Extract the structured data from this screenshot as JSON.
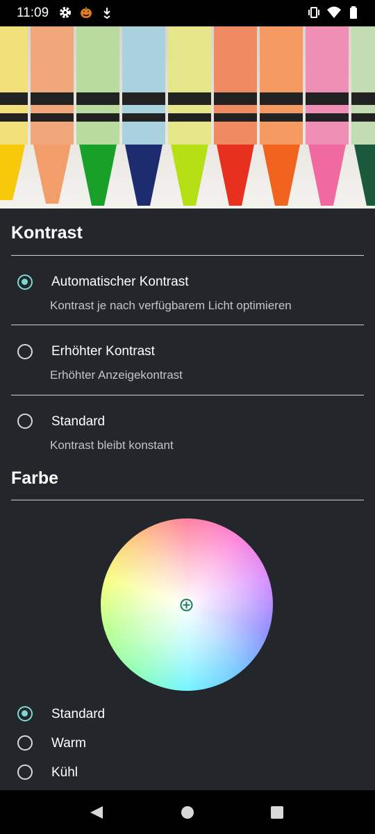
{
  "status_bar": {
    "time": "11:09",
    "icons": [
      "gear-icon",
      "pumpkin-icon",
      "download-icon",
      "vibrate-icon",
      "wifi-icon",
      "battery-icon"
    ]
  },
  "header_image": {
    "description_icon": "crayons-image"
  },
  "kontrast": {
    "title": "Kontrast",
    "options": [
      {
        "label": "Automatischer Kontrast",
        "subtitle": "Kontrast je nach verfügbarem Licht optimieren",
        "checked": true
      },
      {
        "label": "Erhöhter Kontrast",
        "subtitle": "Erhöhter Anzeigekontrast",
        "checked": false
      },
      {
        "label": "Standard",
        "subtitle": "Kontrast bleibt konstant",
        "checked": false
      }
    ]
  },
  "farbe": {
    "title": "Farbe",
    "options": [
      {
        "label": "Standard",
        "checked": true
      },
      {
        "label": "Warm",
        "checked": false
      },
      {
        "label": "Kühl",
        "checked": false
      }
    ]
  },
  "nav_bar": {
    "icons": [
      "back-icon",
      "home-icon",
      "recents-icon"
    ]
  },
  "colors": {
    "accent": "#7fd8cf",
    "background": "#23262b"
  }
}
